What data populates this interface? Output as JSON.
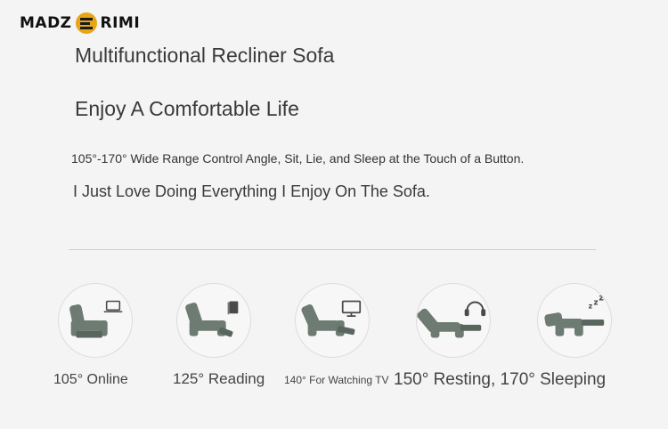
{
  "brand": {
    "name_left": "MADZ",
    "name_right": "RIMI"
  },
  "headline": {
    "title": "Multifunctional Recliner Sofa",
    "subtitle": "Enjoy A Comfortable Life",
    "description": "105°-170° Wide Range Control Angle, Sit, Lie, and Sleep at the Touch of a Button.",
    "tagline": "I Just Love Doing Everything I Enjoy On The Sofa."
  },
  "colors": {
    "sofa": "#6d7b73",
    "sofa_dark": "#58665e",
    "accent_logo": "#e8a516"
  },
  "modes": [
    {
      "label": "105° Online",
      "icon": "laptop-icon"
    },
    {
      "label": "125° Reading",
      "icon": "book-icon"
    },
    {
      "label": "140° For Watching TV",
      "icon": "tv-icon"
    },
    {
      "label": "150° Resting, 170° Sleeping",
      "icon": "headphones-icon"
    },
    {
      "label": "",
      "icon": "sleep-zzz-icon"
    }
  ]
}
